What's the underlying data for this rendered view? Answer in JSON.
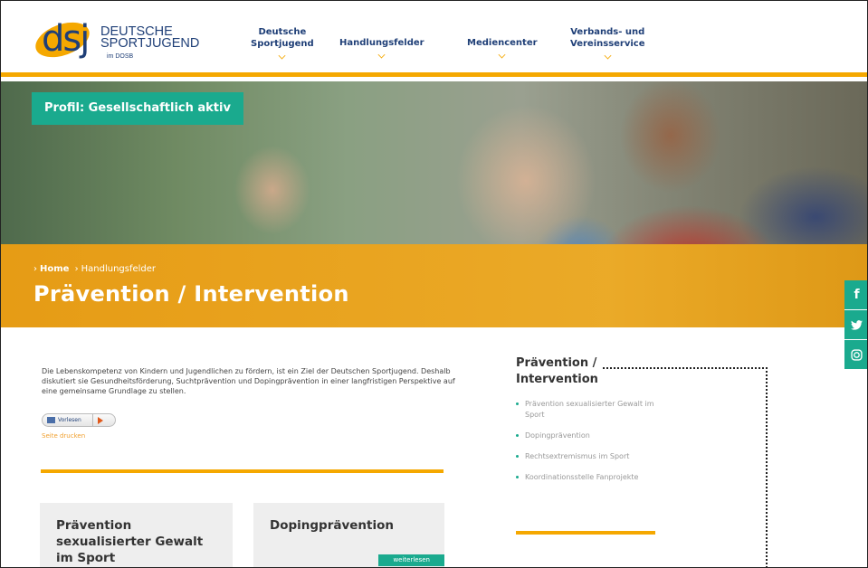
{
  "header": {
    "logo": {
      "mark": "dsj",
      "name_line1": "DEUTSCHE",
      "name_line2": "SPORTJUGEND",
      "sub": "im DOSB"
    },
    "nav": [
      {
        "line1": "Deutsche",
        "line2": "Sportjugend"
      },
      {
        "line1": "Handlungsfelder",
        "line2": ""
      },
      {
        "line1": "Mediencenter",
        "line2": ""
      },
      {
        "line1": "Verbands- und",
        "line2": "Vereinsservice"
      }
    ]
  },
  "hero": {
    "badge": "Profil: Gesellschaftlich aktiv"
  },
  "band": {
    "breadcrumb": {
      "sep": "›",
      "home": "Home",
      "section": "Handlungsfelder"
    },
    "title": "Prävention / Intervention"
  },
  "social": [
    {
      "icon": "facebook-icon",
      "glyph": "f"
    },
    {
      "icon": "twitter-icon",
      "glyph": "🐦"
    },
    {
      "icon": "instagram-icon",
      "glyph": "◎"
    }
  ],
  "main": {
    "intro": "Die Lebenskompetenz von Kindern und Jugendlichen zu fördern, ist ein Ziel der Deutschen Sportjugend. Deshalb diskutiert sie Gesundheitsförderung, Suchtprävention und Dopingprävention in einer langfristigen Perspektive auf eine gemeinsame Grundlage zu stellen.",
    "vorlesen_label": "Vorlesen",
    "links_label": "Seite drucken",
    "cards": [
      {
        "title": "Prävention sexualisierter Gewalt im Sport",
        "more": ""
      },
      {
        "title": "Dopingprävention",
        "more": "weiterlesen"
      }
    ]
  },
  "sidebar": {
    "title_line1": "Prävention /",
    "title_line2": "Intervention",
    "items": [
      "Prävention sexualisierter Gewalt im Sport",
      "Dopingprävention",
      "Rechtsextremismus im Sport",
      "Koordinationsstelle Fanprojekte"
    ]
  },
  "colors": {
    "accent_orange": "#f5a800",
    "accent_teal": "#1aaa8e",
    "brand_blue": "#1f3f77"
  }
}
